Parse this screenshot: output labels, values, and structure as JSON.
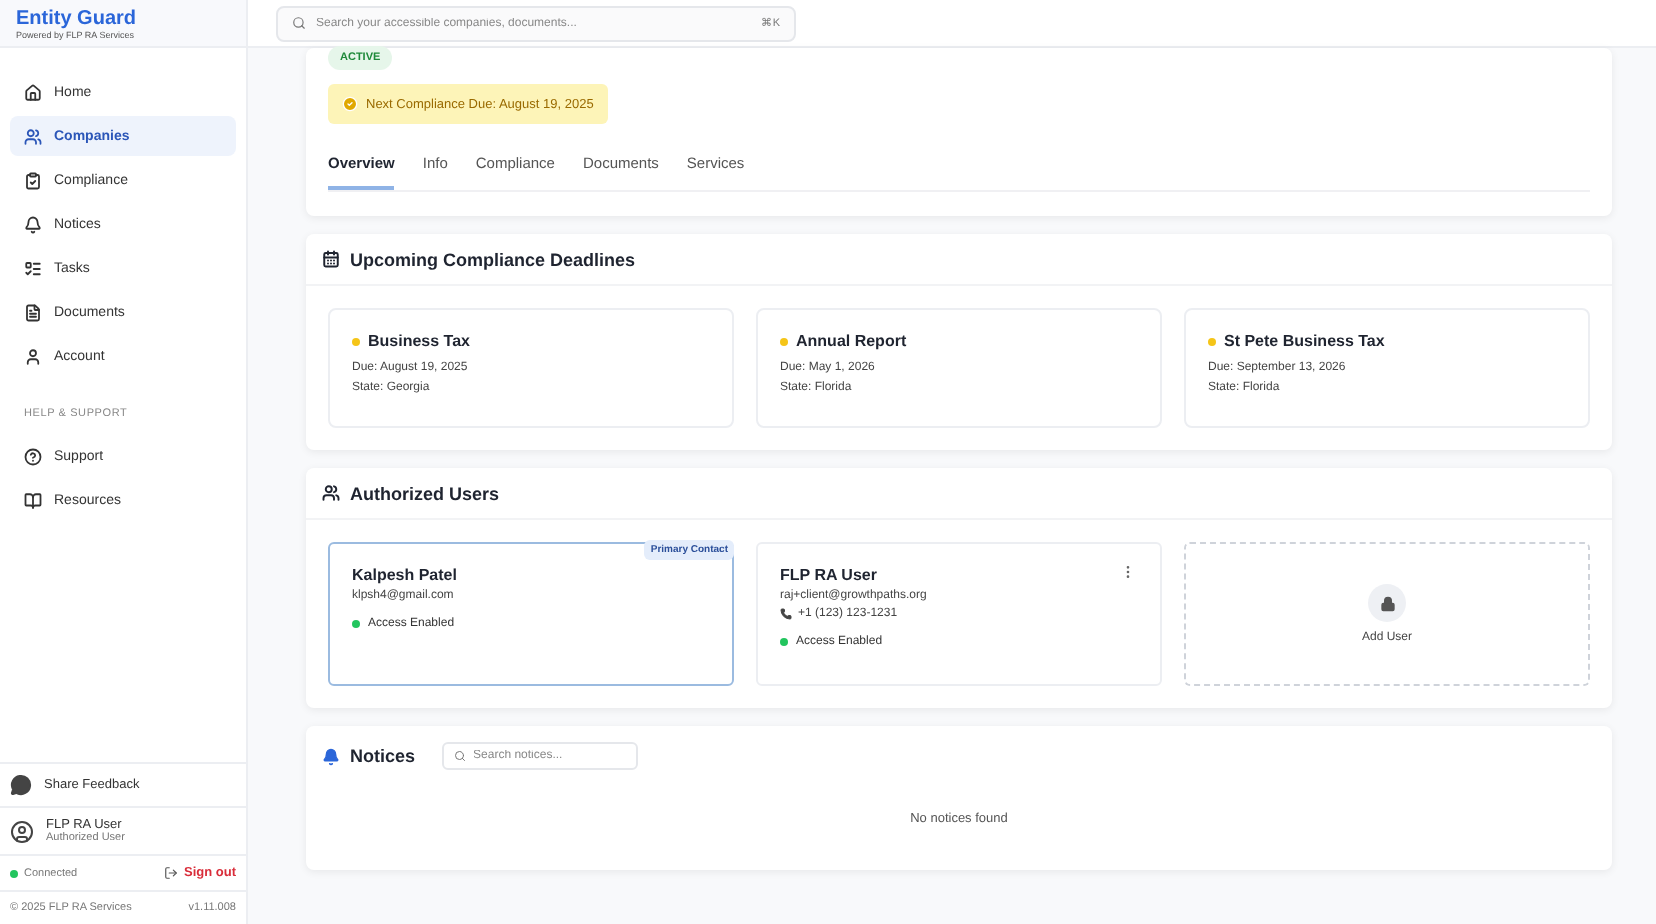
{
  "brand": {
    "title": "Entity Guard",
    "subtitle": "Powered by FLP RA Services"
  },
  "search": {
    "placeholder": "Search your accessible companies, documents...",
    "shortcut": "⌘K"
  },
  "sidebar": {
    "items": [
      {
        "label": "Home",
        "selected": false
      },
      {
        "label": "Companies",
        "selected": true
      },
      {
        "label": "Compliance",
        "selected": false
      },
      {
        "label": "Notices",
        "selected": false
      },
      {
        "label": "Tasks",
        "selected": false
      },
      {
        "label": "Documents",
        "selected": false
      },
      {
        "label": "Account",
        "selected": false
      }
    ],
    "section_title": "HELP & SUPPORT",
    "support_items": [
      {
        "label": "Support",
        "selected": false
      },
      {
        "label": "Resources",
        "selected": false
      }
    ],
    "feedback": "Share Feedback",
    "user": {
      "name": "FLP RA User",
      "role": "Authorized User"
    },
    "connection": {
      "label": "Connected",
      "connected": true
    },
    "sign_out": "Sign out",
    "footer": {
      "copyright": "© 2025 FLP RA Services",
      "version": "v1.11.008"
    }
  },
  "overview": {
    "status": "ACTIVE",
    "next_due": "Next Compliance Due: August 19, 2025",
    "tabs": [
      {
        "label": "Overview",
        "selected": true
      },
      {
        "label": "Info",
        "selected": false
      },
      {
        "label": "Compliance",
        "selected": false
      },
      {
        "label": "Documents",
        "selected": false
      },
      {
        "label": "Services",
        "selected": false
      }
    ]
  },
  "deadlines": {
    "title": "Upcoming Compliance Deadlines",
    "items": [
      {
        "name": "Business Tax",
        "due": "Due: August 19, 2025",
        "state": "State: Georgia",
        "color": "#f5c518"
      },
      {
        "name": "Annual Report",
        "due": "Due: May 1, 2026",
        "state": "State: Florida",
        "color": "#f5c518"
      },
      {
        "name": "St Pete Business Tax",
        "due": "Due: September 13, 2026",
        "state": "State: Florida",
        "color": "#f5c518"
      }
    ]
  },
  "users": {
    "title": "Authorized Users",
    "items": [
      {
        "name": "Kalpesh Patel",
        "email": "klpsh4@gmail.com",
        "badge": "Primary Contact",
        "access": "Access Enabled",
        "primary": true
      },
      {
        "name": "FLP RA User",
        "email": "raj+client@growthpaths.org",
        "phone": "+1 (123) 123-1231",
        "access": "Access Enabled",
        "primary": false
      }
    ],
    "add_label": "Add User"
  },
  "notices": {
    "title": "Notices",
    "placeholder": "Search notices...",
    "empty": "No notices found"
  }
}
